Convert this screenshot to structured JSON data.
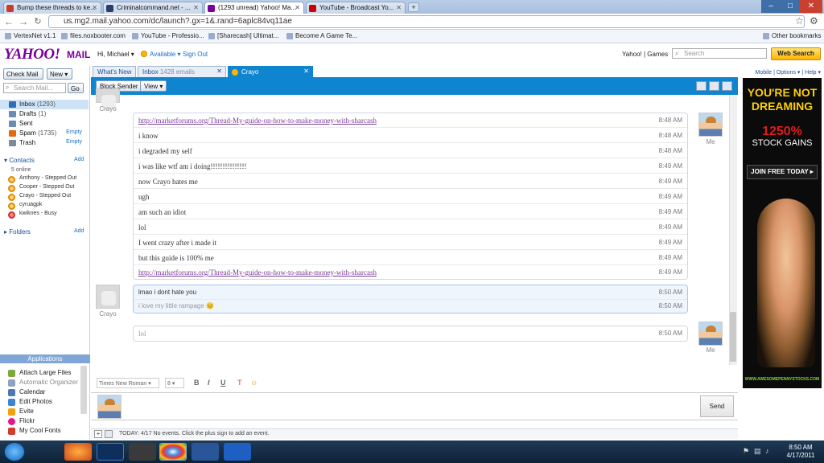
{
  "browser": {
    "tabs": [
      {
        "title": "Bump these threads to ke...",
        "icon_color": "#c93b2a"
      },
      {
        "title": "Criminalcommand.net - ...",
        "icon_color": "#2b3c6b"
      },
      {
        "title": "(1293 unread) Yahoo! Ma...",
        "icon_color": "#7b0099"
      },
      {
        "title": "YouTube - Broadcast Yo...",
        "icon_color": "#cc0000"
      }
    ],
    "new_tab": "+",
    "url": "us.mg2.mail.yahoo.com/dc/launch?.gx=1&.rand=6aplc84vq11ae",
    "bookmarks": [
      "VertexNet v1.1",
      "files.noxbooter.com",
      "YouTube - Professio...",
      "[Sharecash] Ultimat...",
      "Become A Game Te..."
    ],
    "other_bookmarks": "Other bookmarks",
    "window_controls": [
      "–",
      "□",
      "✕"
    ]
  },
  "header": {
    "logo": "YAHOO!",
    "product": "MAIL",
    "greeting": "Hi, Michael ▾",
    "status": "Available ▾",
    "sign_out": "Sign Out",
    "right_links": "Yahoo! | Games",
    "search_placeholder": "Search",
    "web_search": "Web Search",
    "util_links": "Mobile | Options ▾ | Help ▾"
  },
  "sidebar": {
    "check_mail": "Check Mail",
    "new": "New ▾",
    "search_mail_placeholder": "Search Mail...",
    "go": "Go",
    "folders": [
      {
        "name": "Inbox",
        "count": "(1293)",
        "color": "#2f6db5"
      },
      {
        "name": "Drafts",
        "count": "(1)",
        "color": "#6a8bb8"
      },
      {
        "name": "Sent",
        "count": "",
        "color": "#6a8bb8"
      },
      {
        "name": "Spam",
        "count": "(1735)",
        "color": "#e06b12",
        "action": "Empty"
      },
      {
        "name": "Trash",
        "count": "",
        "color": "#7d8a99",
        "action": "Empty"
      }
    ],
    "contacts_label": "Contacts",
    "contacts_add": "Add",
    "online_count": "5 online",
    "contacts": [
      "Anthony - Stepped Out",
      "Cooper - Stepped Out",
      "Crayo - Stepped Out",
      "cyruagpk",
      "kwiknes - Busy"
    ],
    "folders_label": "Folders",
    "folders_add": "Add",
    "applications_label": "Applications",
    "apps": [
      {
        "name": "Attach Large Files",
        "color": "#7caa3c"
      },
      {
        "name": "Automatic Organizer",
        "color": "#8ea3bd"
      },
      {
        "name": "Calendar",
        "color": "#4d77b5"
      },
      {
        "name": "Edit Photos",
        "color": "#3a87d0"
      },
      {
        "name": "Evite",
        "color": "#f2a20f"
      },
      {
        "name": "Flickr",
        "color": "#e0188a"
      },
      {
        "name": "My Cool Fonts",
        "color": "#d33b2b"
      }
    ]
  },
  "mail_tabs": [
    {
      "label": "What's New"
    },
    {
      "label": "Inbox",
      "count": "1428 emails"
    },
    {
      "label": "Crayo"
    }
  ],
  "toolbar": {
    "block_sender": "Block Sender",
    "view": "View ▾"
  },
  "chat": {
    "crayo_name": "Crayo",
    "me_name": "Me",
    "block1": [
      {
        "text": "http://marketforums.org/Thread-My-guide-on-how-to-make-money-with-sharcash",
        "time": "8:48 AM",
        "link": true
      },
      {
        "text": "i know",
        "time": "8:48 AM"
      },
      {
        "text": "i degraded my self",
        "time": "8:48 AM"
      },
      {
        "text": "i was like wtf am i doing!!!!!!!!!!!!!!!",
        "time": "8:49 AM"
      },
      {
        "text": "now Crayo hates me",
        "time": "8:49 AM"
      },
      {
        "text": "ugh",
        "time": "8:49 AM"
      },
      {
        "text": "am such an idiot",
        "time": "8:49 AM"
      },
      {
        "text": "lol",
        "time": "8:49 AM"
      },
      {
        "text": "I went crazy after i made it",
        "time": "8:49 AM"
      },
      {
        "text": "but this guide is 100% me",
        "time": "8:49 AM"
      },
      {
        "text": "http://marketforums.org/Thread-My-guide-on-how-to-make-money-with-sharcash",
        "time": "8:49 AM",
        "link": true
      }
    ],
    "block2": [
      {
        "text": "lmao i dont hate you",
        "time": "8:50 AM"
      },
      {
        "text": "i love my little rampage 😊",
        "time": "8:50 AM"
      }
    ],
    "block3": [
      {
        "text": "lol",
        "time": "8:50 AM"
      }
    ]
  },
  "composer": {
    "font": "Times New Roman ▾",
    "size": "8 ▾",
    "bold": "B",
    "italic": "I",
    "underline": "U",
    "color": "T",
    "emoticon": "☺",
    "send": "Send"
  },
  "calendar_tray": {
    "text": "TODAY: 4/17   No events. Click the plus sign to add an event."
  },
  "ad": {
    "line1": "YOU'RE NOT",
    "line2": "DREAMING",
    "percent": "1250%",
    "line3": "STOCK GAINS",
    "cta": "JOIN FREE TODAY ▸",
    "footer": "WWW.AWESOMEPENNYSTOCKS.COM"
  },
  "taskbar": {
    "time": "8:50 AM",
    "date": "4/17/2011"
  }
}
